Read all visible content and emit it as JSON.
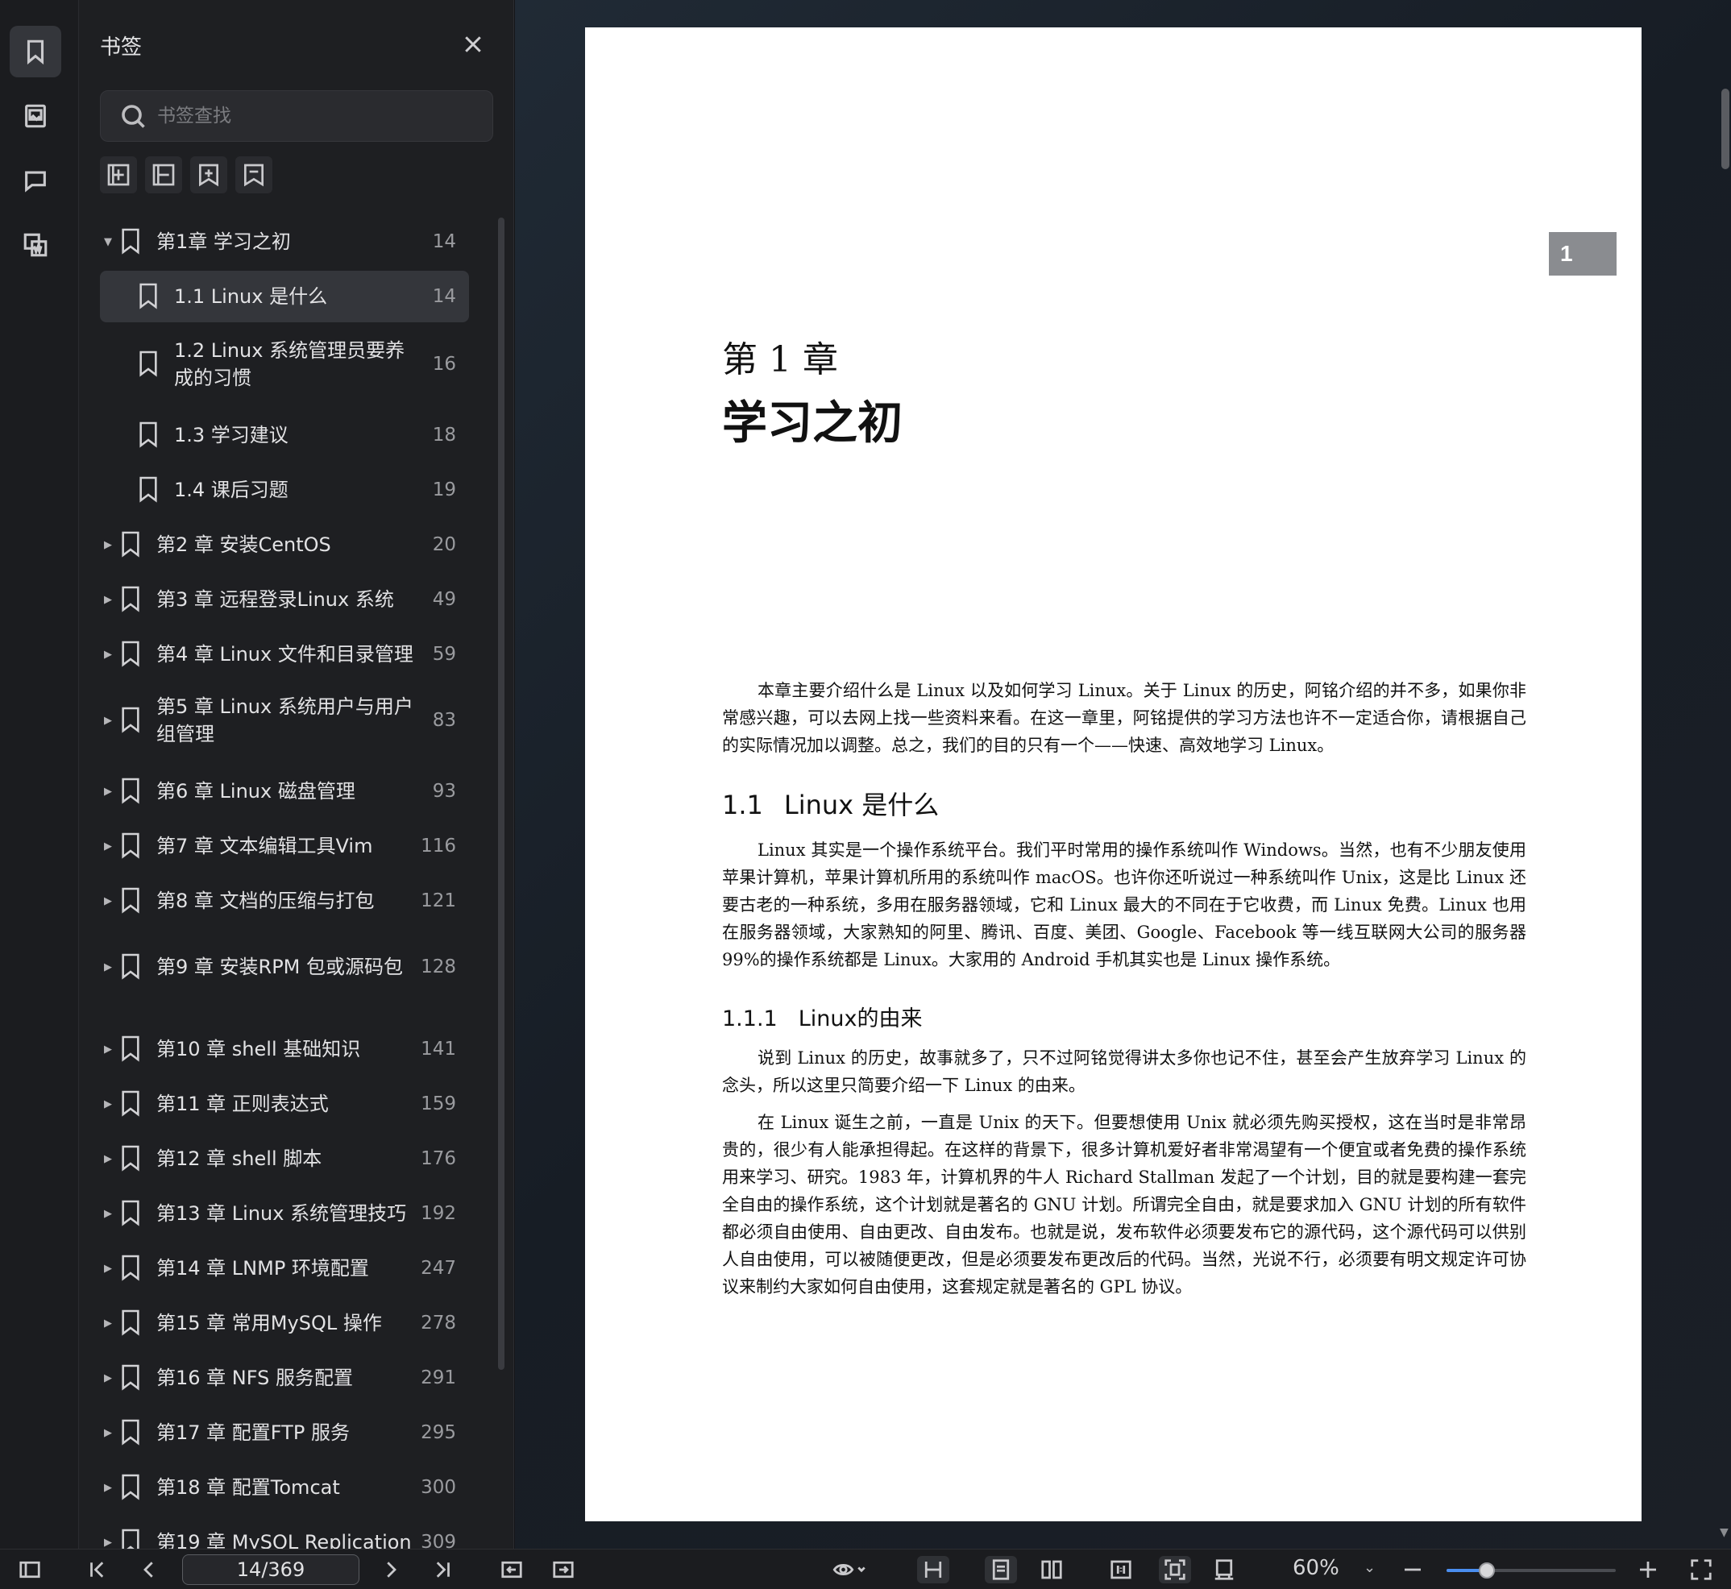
{
  "sidebar_panel": {
    "title": "书签",
    "search_placeholder": "书签查找"
  },
  "bookmarks": [
    {
      "label": "第1章 学习之初",
      "page": "14",
      "level": 0,
      "expanded": true
    },
    {
      "label": "1.1 Linux 是什么",
      "page": "14",
      "level": 1,
      "selected": true
    },
    {
      "label": "1.2 Linux 系统管理员要养成的习惯",
      "page": "16",
      "level": 1
    },
    {
      "label": "1.3 学习建议",
      "page": "18",
      "level": 1
    },
    {
      "label": "1.4 课后习题",
      "page": "19",
      "level": 1
    },
    {
      "label": "第2 章 安装CentOS",
      "page": "20",
      "level": 0
    },
    {
      "label": "第3 章 远程登录Linux 系统",
      "page": "49",
      "level": 0
    },
    {
      "label": "第4 章 Linux 文件和目录管理",
      "page": "59",
      "level": 0
    },
    {
      "label": "第5 章 Linux 系统用户与用户组管理",
      "page": "83",
      "level": 0
    },
    {
      "label": "第6 章 Linux 磁盘管理",
      "page": "93",
      "level": 0
    },
    {
      "label": "第7 章 文本编辑工具Vim",
      "page": "116",
      "level": 0
    },
    {
      "label": "第8 章 文档的压缩与打包",
      "page": "121",
      "level": 0
    },
    {
      "label": "第9 章 安装RPM 包或源码包",
      "page": "128",
      "level": 0
    },
    {
      "label": "第10 章 shell 基础知识",
      "page": "141",
      "level": 0
    },
    {
      "label": "第11 章 正则表达式",
      "page": "159",
      "level": 0
    },
    {
      "label": "第12 章 shell 脚本",
      "page": "176",
      "level": 0
    },
    {
      "label": "第13 章 Linux 系统管理技巧",
      "page": "192",
      "level": 0
    },
    {
      "label": "第14 章 LNMP 环境配置",
      "page": "247",
      "level": 0
    },
    {
      "label": "第15 章 常用MySQL 操作",
      "page": "278",
      "level": 0
    },
    {
      "label": "第16 章 NFS 服务配置",
      "page": "291",
      "level": 0
    },
    {
      "label": "第17 章 配置FTP 服务",
      "page": "295",
      "level": 0
    },
    {
      "label": "第18 章 配置Tomcat",
      "page": "300",
      "level": 0
    },
    {
      "label": "第19 章 MySQL Replication",
      "page": "309",
      "level": 0
    }
  ],
  "document": {
    "page_badge": "1",
    "chapter_number": "第 1 章",
    "chapter_title": "学习之初",
    "intro": "本章主要介绍什么是 Linux 以及如何学习 Linux。关于 Linux 的历史，阿铭介绍的并不多，如果你非常感兴趣，可以去网上找一些资料来看。在这一章里，阿铭提供的学习方法也许不一定适合你，请根据自己的实际情况加以调整。总之，我们的目的只有一个——快速、高效地学习 Linux。",
    "section_num": "1.1",
    "section_title": "Linux 是什么",
    "section_para": "Linux 其实是一个操作系统平台。我们平时常用的操作系统叫作 Windows。当然，也有不少朋友使用苹果计算机，苹果计算机所用的系统叫作 macOS。也许你还听说过一种系统叫作 Unix，这是比 Linux 还要古老的一种系统，多用在服务器领域，它和 Linux 最大的不同在于它收费，而 Linux 免费。Linux 也用在服务器领域，大家熟知的阿里、腾讯、百度、美团、Google、Facebook 等一线互联网大公司的服务器 99%的操作系统都是 Linux。大家用的 Android 手机其实也是 Linux 操作系统。",
    "subsection_num": "1.1.1",
    "subsection_title": "Linux的由来",
    "sub_para1": "说到 Linux 的历史，故事就多了，只不过阿铭觉得讲太多你也记不住，甚至会产生放弃学习 Linux 的念头，所以这里只简要介绍一下 Linux 的由来。",
    "sub_para2": "在 Linux 诞生之前，一直是 Unix 的天下。但要想使用 Unix 就必须先购买授权，这在当时是非常昂贵的，很少有人能承担得起。在这样的背景下，很多计算机爱好者非常渴望有一个便宜或者免费的操作系统用来学习、研究。1983 年，计算机界的牛人 Richard Stallman 发起了一个计划，目的就是要构建一套完全自由的操作系统，这个计划就是著名的 GNU 计划。所谓完全自由，就是要求加入 GNU 计划的所有软件都必须自由使用、自由更改、自由发布。也就是说，发布软件必须要发布它的源代码，这个源代码可以供别人自由使用，可以被随便更改，但是必须要发布更改后的代码。当然，光说不行，必须要有明文规定许可协议来制约大家如何自由使用，这套规定就是著名的 GPL 协议。"
  },
  "bottombar": {
    "page_indicator": "14/369",
    "zoom": "60%",
    "zoom_level": 0.24
  }
}
